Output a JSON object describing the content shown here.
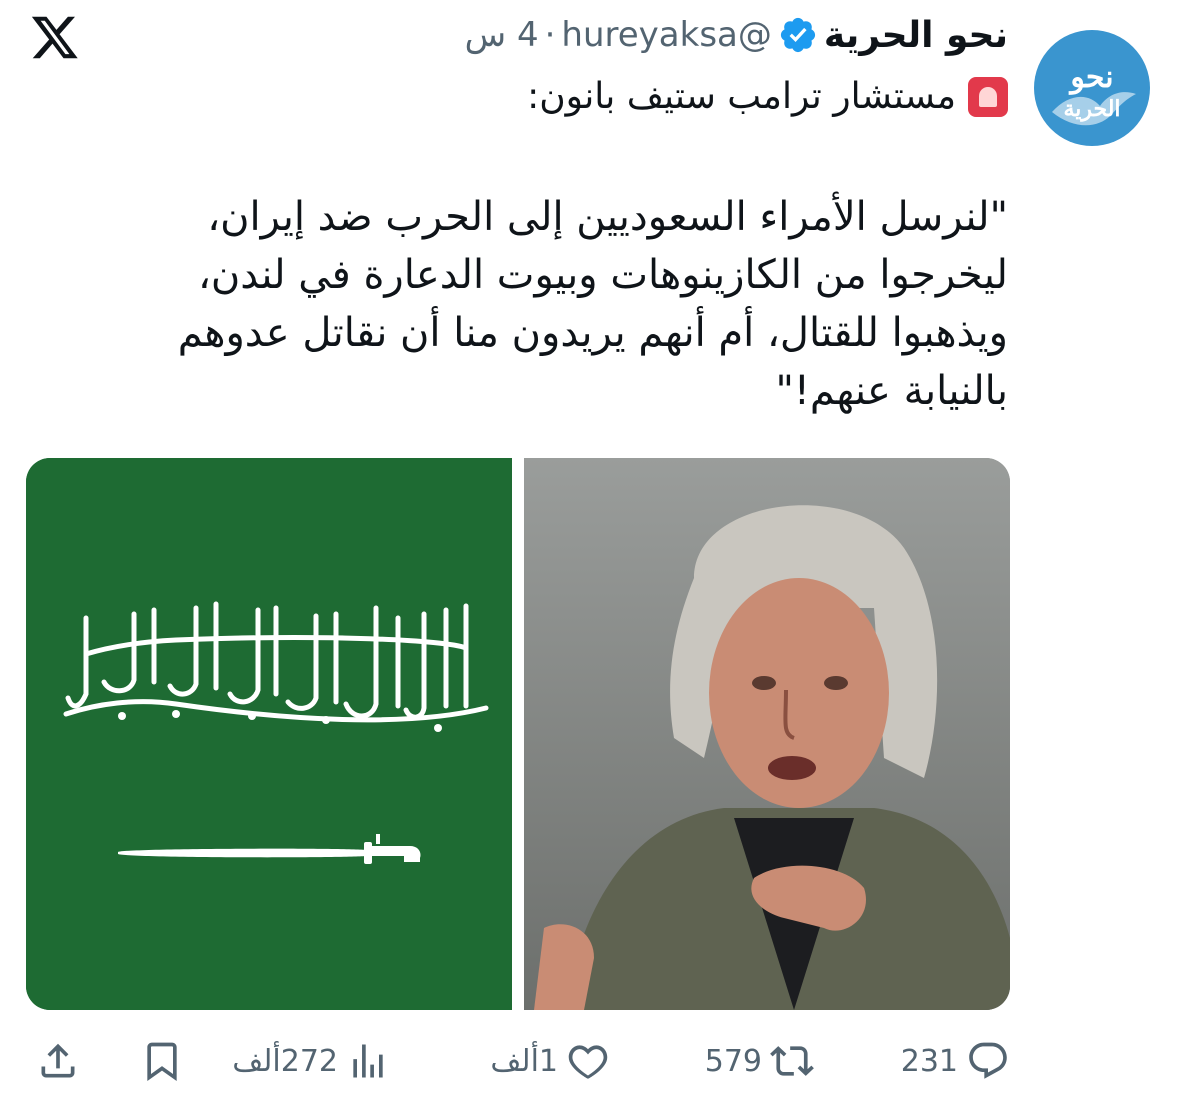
{
  "author": {
    "display_name": "نحو الحرية",
    "handle": "@hureyaksa",
    "time": "4 س",
    "separator": "·",
    "avatar_line1": "نحو",
    "avatar_line2": "الحرية",
    "verified_icon": "verified-badge-icon"
  },
  "tweet": {
    "heading": "مستشار ترامب ستيف بانون:",
    "heading_emoji": "rotating-light-icon",
    "lines": [
      "\"لنرسل الأمراء السعوديين إلى الحرب ضد إيران،",
      "ليخرجوا من الكازينوهات وبيوت الدعارة في لندن،",
      "ويذهبوا للقتال، أم أنهم يريدون منا أن نقاتل عدوهم",
      "بالنيابة عنهم!\""
    ]
  },
  "actions": {
    "replies": "231",
    "reposts": "579",
    "likes": "1ألف",
    "views": "272ألف"
  },
  "colors": {
    "flag_green": "#1e6b33",
    "avatar_blue": "#3a95cf",
    "verified_blue": "#1d9bf0",
    "muted_text": "#536471"
  }
}
